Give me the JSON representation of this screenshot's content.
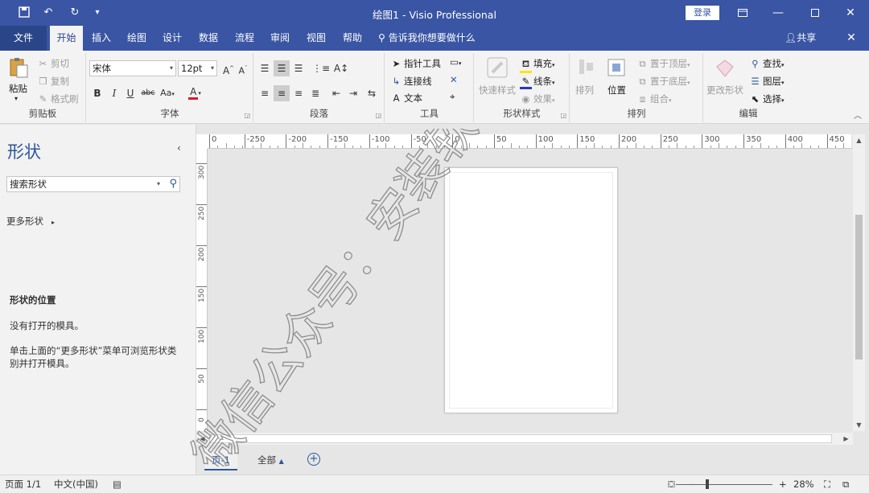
{
  "titlebar": {
    "title": "绘图1 - Visio Professional",
    "login": "登录",
    "icons": [
      "save-icon",
      "undo-icon",
      "redo-icon",
      "customize-quick-access-icon",
      "ribbon-display-icon",
      "minimize-icon",
      "maximize-icon",
      "close-icon"
    ]
  },
  "tabs": {
    "file": "文件",
    "items": [
      "开始",
      "插入",
      "绘图",
      "设计",
      "数据",
      "流程",
      "审阅",
      "视图",
      "帮助"
    ],
    "active": "开始",
    "tell_me": "告诉我你想要做什么",
    "share": "共享"
  },
  "ribbon": {
    "clipboard": {
      "label": "剪贴板",
      "paste": "粘贴",
      "cut": "剪切",
      "copy": "复制",
      "format_painter": "格式刷"
    },
    "font": {
      "label": "字体",
      "font_name": "宋体",
      "font_size": "12pt",
      "grow": "A",
      "shrink": "A",
      "bold": "B",
      "italic": "I",
      "underline": "U",
      "strike": "abc",
      "case": "Aa",
      "color": "A"
    },
    "paragraph": {
      "label": "段落"
    },
    "tools": {
      "label": "工具",
      "pointer": "指针工具",
      "connector": "连接线",
      "text": "文本"
    },
    "shape_styles": {
      "label": "形状样式",
      "quick_styles": "快速样式",
      "fill": "填充",
      "line": "线条",
      "effects": "效果"
    },
    "arrange": {
      "label": "排列",
      "align": "排列",
      "position": "位置",
      "bring_front": "置于顶层",
      "send_back": "置于底层",
      "group": "组合"
    },
    "editing": {
      "label": "编辑",
      "change_shape": "更改形状",
      "find": "查找",
      "layers": "图层",
      "select": "选择"
    },
    "collapse_icon": "chevron-up-icon"
  },
  "shapes_pane": {
    "title": "形状",
    "search_placeholder": "搜索形状",
    "more_shapes": "更多形状",
    "location_title": "形状的位置",
    "no_stencils": "没有打开的模具。",
    "hint": "单击上面的“更多形状”菜单可浏览形状类别并打开模具。"
  },
  "rulers": {
    "h_ticks": [
      "0",
      "-250",
      "-200",
      "-150",
      "-100",
      "-50",
      "0",
      "50",
      "100",
      "150",
      "200",
      "250",
      "300",
      "350",
      "400",
      "450"
    ],
    "v_ticks": [
      "300",
      "250",
      "200",
      "150",
      "100",
      "50",
      "0"
    ]
  },
  "page_tabs": {
    "page1": "页-1",
    "all": "全部",
    "all_arrow": "▲",
    "add": "+"
  },
  "statusbar": {
    "page": "页面 1/1",
    "language": "中文(中国)",
    "zoom": "28%",
    "zoom_minus": "−",
    "zoom_plus": "+"
  },
  "watermark": "微信公众号：安装软件指南",
  "colors": {
    "accent": "#3955a3",
    "accent_dark": "#2b579a"
  }
}
